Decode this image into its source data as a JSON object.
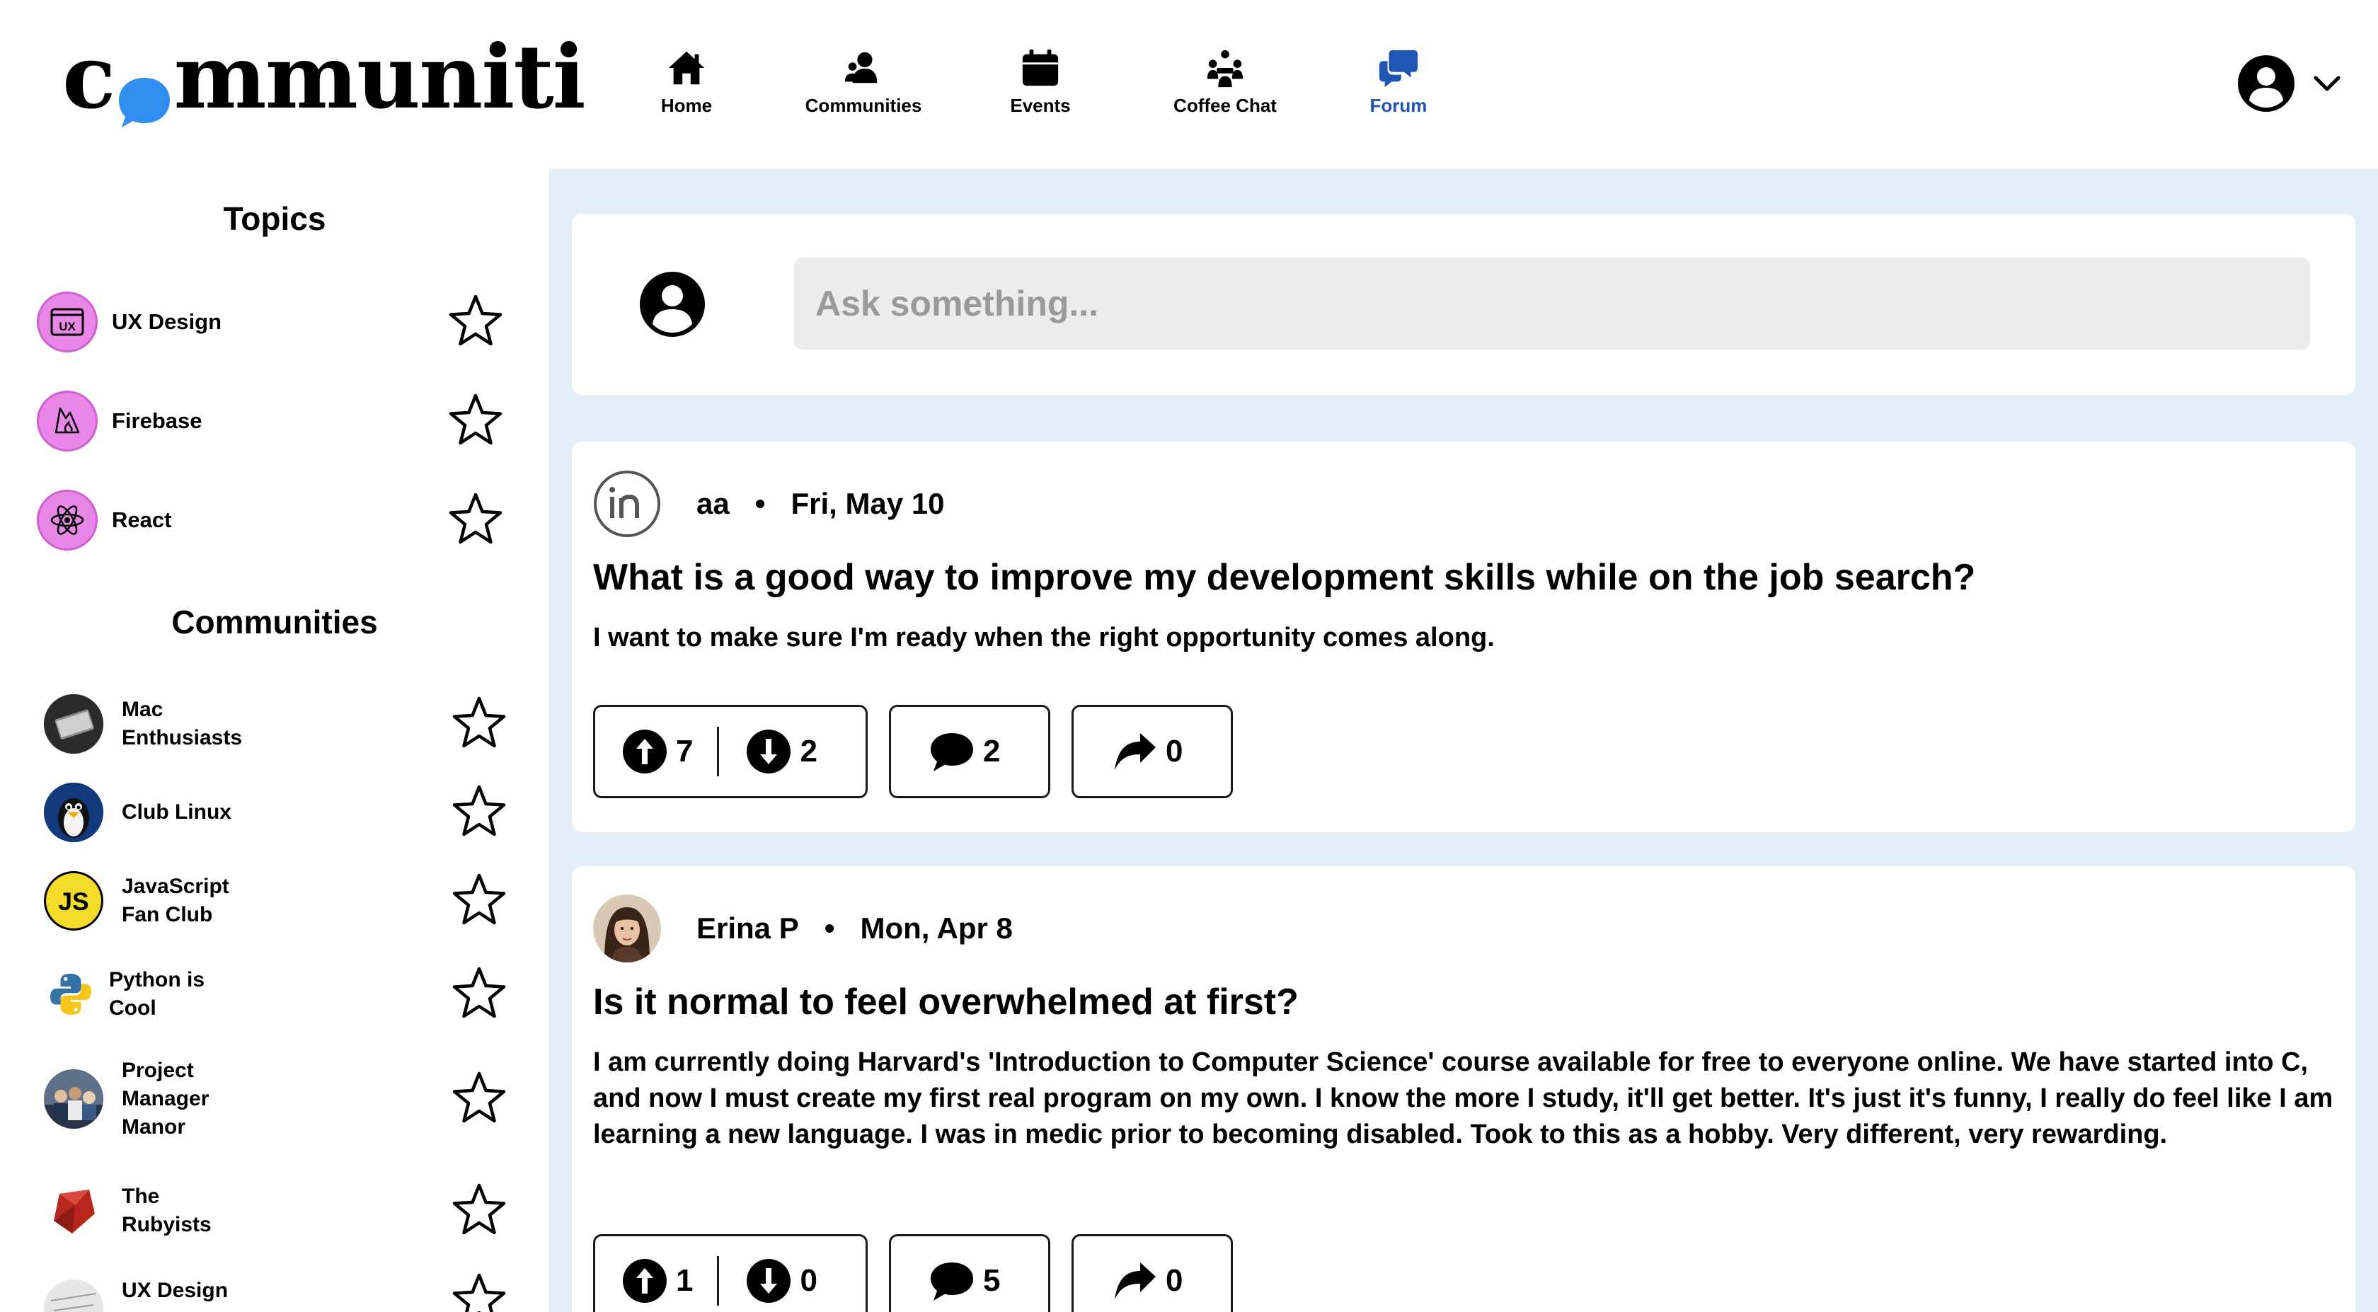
{
  "header": {
    "logo": "communiti",
    "nav": [
      {
        "label": "Home",
        "icon": "home-icon"
      },
      {
        "label": "Communities",
        "icon": "communities-icon"
      },
      {
        "label": "Events",
        "icon": "calendar-icon"
      },
      {
        "label": "Coffee Chat",
        "icon": "coffee-chat-icon"
      },
      {
        "label": "Forum",
        "icon": "forum-icon",
        "active": true
      }
    ],
    "active_color": "#1f56b3"
  },
  "sidebar": {
    "topics_title": "Topics",
    "topics": [
      {
        "label": "UX Design",
        "icon": "ux-icon"
      },
      {
        "label": "Firebase",
        "icon": "firebase-icon"
      },
      {
        "label": "React",
        "icon": "react-icon"
      }
    ],
    "communities_title": "Communities",
    "communities": [
      {
        "label": "Mac Enthusiasts",
        "lines": [
          "Mac",
          "Enthusiasts"
        ]
      },
      {
        "label": "Club Linux",
        "lines": [
          "Club Linux"
        ]
      },
      {
        "label": "JavaScript Fan Club",
        "lines": [
          "JavaScript",
          "Fan Club"
        ]
      },
      {
        "label": "Python is Cool",
        "lines": [
          "Python is",
          "Cool"
        ]
      },
      {
        "label": "Project Manager Manor",
        "lines": [
          "Project",
          "Manager",
          "Manor"
        ]
      },
      {
        "label": "The Rubyists",
        "lines": [
          "The",
          "Rubyists"
        ]
      },
      {
        "label": "UX Design",
        "lines": [
          "UX Design"
        ]
      }
    ]
  },
  "composer": {
    "placeholder": "Ask something..."
  },
  "posts": [
    {
      "author": "aa",
      "date": "Fri, May 10",
      "title": "What is a good way to improve my development skills while on the job search?",
      "body": "I want to make sure I'm ready when the right opportunity comes along.",
      "upvotes": "7",
      "downvotes": "2",
      "comments": "2",
      "shares": "0"
    },
    {
      "author": "Erina P",
      "date": "Mon, Apr 8",
      "title": "Is it normal to feel overwhelmed at first?",
      "body": "I am currently doing Harvard's 'Introduction to Computer Science' course available for free to everyone online. We have started into C, and now I must create my first real program on my own. I know the more I study, it'll get better. It's just it's funny, I really do feel like I am learning a new language. I was in medic prior to becoming disabled. Took to this as a hobby. Very different, very rewarding.",
      "upvotes": "1",
      "downvotes": "0",
      "comments": "5",
      "shares": "0"
    }
  ],
  "colors": {
    "main_bg": "#e3eef8",
    "topic_icon_bg": "#e887e8",
    "input_bg": "#ececec"
  }
}
